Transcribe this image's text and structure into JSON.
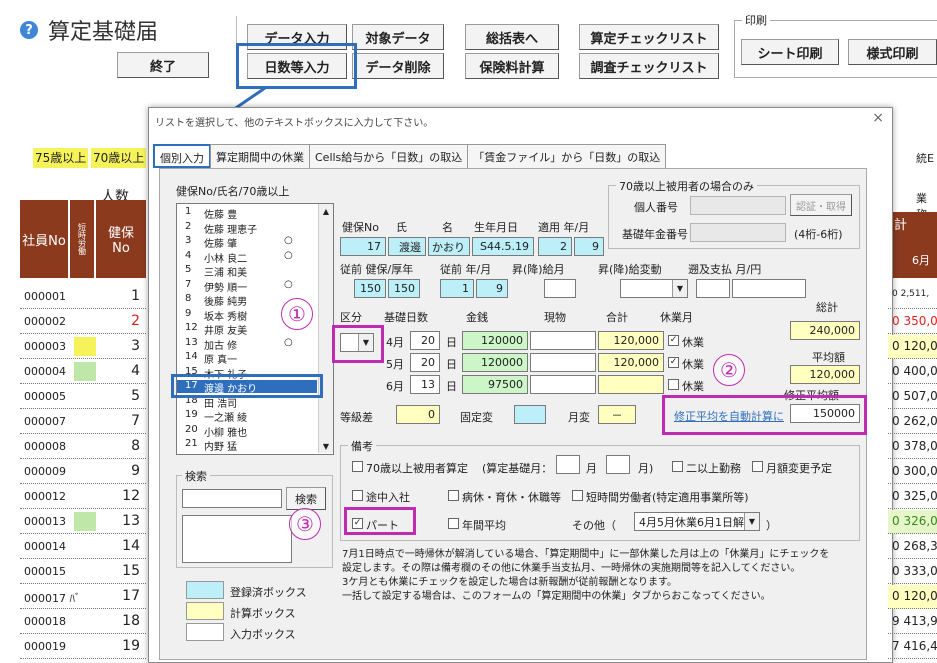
{
  "app": {
    "title": "算定基礎届",
    "help_icon": "question-circle-icon"
  },
  "toolbar": {
    "end": "終了",
    "data_input": "データ入力",
    "target_data": "対象データ",
    "summary": "総括表へ",
    "check_list": "算定チェックリスト",
    "days_input": "日数等入力",
    "data_delete": "データ削除",
    "premium_calc": "保険料計算",
    "survey_check": "調査チェックリスト",
    "print_group": "印刷",
    "sheet_print": "シート印刷",
    "form_print": "様式印刷"
  },
  "sheet": {
    "age75": "75歳以上",
    "age70": "70歳以上",
    "count_label": "人数",
    "col_empno": "社員No",
    "col_flags": "短時労働",
    "col_kenpo_l1": "健保",
    "col_kenpo_l2": "No",
    "right_top": "統E",
    "right_head": "業称",
    "right_total": "計",
    "right_month": "6月",
    "rows": [
      {
        "no": "000001",
        "idx": "1",
        "val": "0 2,511,"
      },
      {
        "no": "000002",
        "idx": "2",
        "val": "0 350,0"
      },
      {
        "no": "000003",
        "idx": "3",
        "val": "0 120,0"
      },
      {
        "no": "000004",
        "idx": "4",
        "val": "0 400,0"
      },
      {
        "no": "000005",
        "idx": "5",
        "val": "0 507,0"
      },
      {
        "no": "000007",
        "idx": "7",
        "val": "0 262,0"
      },
      {
        "no": "000008",
        "idx": "8",
        "val": "0 378,0"
      },
      {
        "no": "000009",
        "idx": "9",
        "val": "0 300,0"
      },
      {
        "no": "000012",
        "idx": "12",
        "val": "0 325,0"
      },
      {
        "no": "000013",
        "idx": "13",
        "val": "0 326,0"
      },
      {
        "no": "000014",
        "idx": "14",
        "val": "0 268,3"
      },
      {
        "no": "000015",
        "idx": "15",
        "val": "0 333,0"
      },
      {
        "no": "000017 ﾊﾞ",
        "idx": "17",
        "val": "0 120,0"
      },
      {
        "no": "000018",
        "idx": "18",
        "val": "9 413,9"
      },
      {
        "no": "000019",
        "idx": "19",
        "val": "7 416,4"
      }
    ]
  },
  "dialog": {
    "title": "リストを選択して、他のテキストボックスに入力して下さい。",
    "close": "×",
    "tabs": [
      "個別入力",
      "算定期間中の休業",
      "Cells給与から「日数」の取込",
      "「賃金ファイル」から「日数」の取込"
    ],
    "list_header": "健保No/氏名/70歳以上",
    "employees": [
      {
        "n": "1",
        "name": "佐藤 豊",
        "mark": ""
      },
      {
        "n": "2",
        "name": "佐藤 理恵子",
        "mark": ""
      },
      {
        "n": "3",
        "name": "佐藤 肇",
        "mark": "○"
      },
      {
        "n": "4",
        "name": "小林 良二",
        "mark": "○"
      },
      {
        "n": "5",
        "name": "三浦 和美",
        "mark": ""
      },
      {
        "n": "7",
        "name": "伊勢 順一",
        "mark": "○"
      },
      {
        "n": "8",
        "name": "後藤 純男",
        "mark": ""
      },
      {
        "n": "9",
        "name": "坂本 秀樹",
        "mark": ""
      },
      {
        "n": "12",
        "name": "井原 友美",
        "mark": ""
      },
      {
        "n": "13",
        "name": "加古 修",
        "mark": "○"
      },
      {
        "n": "14",
        "name": "原 真一",
        "mark": ""
      },
      {
        "n": "15",
        "name": "木下 礼子",
        "mark": ""
      },
      {
        "n": "17",
        "name": "渡邊 かおり",
        "mark": ""
      },
      {
        "n": "18",
        "name": "田 浩司",
        "mark": ""
      },
      {
        "n": "19",
        "name": "一之瀬 綾",
        "mark": ""
      },
      {
        "n": "20",
        "name": "小柳 雅也",
        "mark": ""
      },
      {
        "n": "21",
        "name": "内野 猛",
        "mark": ""
      }
    ],
    "search_group": "検索",
    "search_button": "検索",
    "legend": {
      "reg": "登録済ボックス",
      "calc": "計算ボックス",
      "input": "入力ボックス"
    },
    "head_labels": {
      "kenpo_no": "健保No",
      "last": "氏",
      "first": "名",
      "birth": "生年月日",
      "applied": "適用 年/月"
    },
    "emp": {
      "kenpo_no": "17",
      "last": "渡邊",
      "first": "かおり",
      "birth": "S44.5.19",
      "year": "2",
      "month": "9"
    },
    "prev_labels": {
      "prev_std": "従前 健保/厚年",
      "prev_ym": "従前 年/月",
      "raise_month": "昇(降)給月",
      "raise_change": "昇(降)給変動",
      "retro": "遡及支払 月/円"
    },
    "prev": {
      "kenpo": "150",
      "kounen": "150",
      "year": "1",
      "month": "9"
    },
    "aged70": {
      "group": "70歳以上被用者の場合のみ",
      "personal_no": "個人番号",
      "pension_no": "基礎年金番号",
      "auth_button": "認証・取得",
      "digits": "(4桁-6桁)"
    },
    "grid_labels": {
      "kubun": "区分",
      "base_days": "基礎日数",
      "cash": "金銭",
      "goods": "現物",
      "sum": "合計",
      "leave": "休業月",
      "day_unit": "日"
    },
    "months": [
      {
        "m": "4月",
        "days": "20",
        "cash": "120000",
        "sum": "120,000",
        "leave": "休業",
        "checked": true
      },
      {
        "m": "5月",
        "days": "20",
        "cash": "120000",
        "sum": "120,000",
        "leave": "休業",
        "checked": true
      },
      {
        "m": "6月",
        "days": "13",
        "cash": "97500",
        "sum": "",
        "leave": "休業",
        "checked": false
      }
    ],
    "totals": {
      "total_label": "総計",
      "total": "240,000",
      "avg_label": "平均額",
      "avg": "120,000",
      "corr_label": "修正平均額",
      "auto_calc": "修正平均を自動計算に",
      "corr_value": "150000"
    },
    "grade": {
      "label": "等級差",
      "value": "0",
      "fixed": "固定変",
      "monthly": "月変",
      "monthly_value": "－"
    },
    "remarks": {
      "group": "備考",
      "aged70_calc": "70歳以上被用者算定",
      "base_month": "(算定基礎月：",
      "month_unit": "月",
      "month_close": "月)",
      "two_offices": "二以上勤務",
      "monthly_change_plan": "月額変更予定",
      "mid_join": "途中入社",
      "sick_leave": "病休・育休・休職等",
      "short_time": "短時間労働者(特定適用事業所等)",
      "part": "パート",
      "annual_avg": "年間平均",
      "other": "その他（",
      "other_value": "4月5月休業6月1日解消",
      "other_close": "）"
    },
    "notes": [
      "7月1日時点で一時帰休が解消している場合、「算定期間中」に一部休業した月は上の「休業月」にチェックを",
      "設定します。その際は備考欄のその他に休業手当支払月、一時帰休の実施期間等を記入してください。",
      "3ケ月とも休業にチェックを設定した場合は新報酬が従前報酬となります。",
      "一括して設定する場合は、このフォームの「算定期間中の休業」タブからおこなってください。"
    ]
  },
  "annotations": {
    "c1": "①",
    "c2": "②",
    "c3": "③"
  },
  "colors": {
    "accent_blue": "#2f6ebd",
    "magenta": "#c02bb3",
    "header_brown": "#8b3a1e",
    "registered": "#bdeff9",
    "calculated": "#ffffc0"
  }
}
